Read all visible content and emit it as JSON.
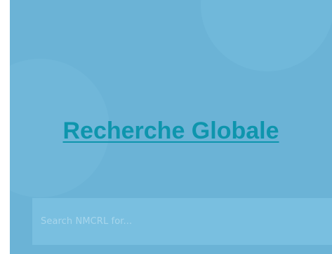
{
  "main": {
    "heading_link": "Recherche Globale",
    "search": {
      "placeholder": "Search NMCRL for..."
    }
  },
  "colors": {
    "panel_background": "#6bb3d6",
    "link": "#0e95ad",
    "search_field": "#79bfe0",
    "placeholder_text": "#a7d6ec"
  }
}
